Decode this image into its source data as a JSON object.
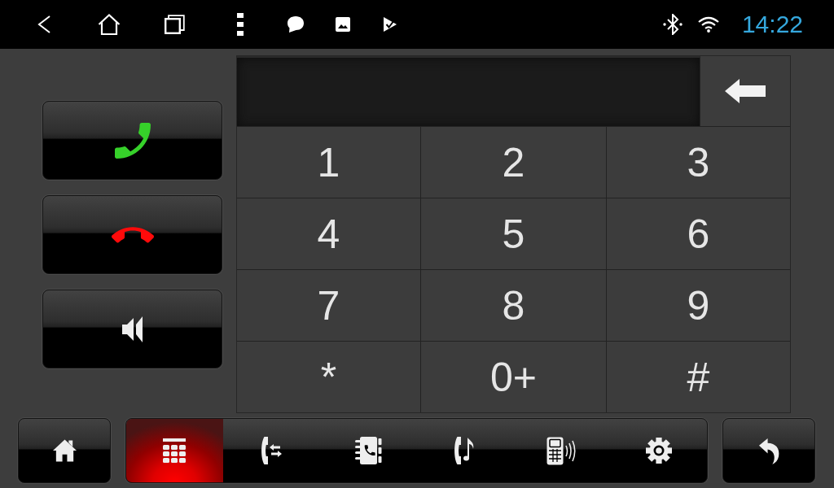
{
  "status_bar": {
    "time": "14:22"
  },
  "call_buttons": [
    {
      "kind": "answer"
    },
    {
      "kind": "hangup"
    },
    {
      "kind": "speaker"
    }
  ],
  "keypad": {
    "keys": [
      "1",
      "2",
      "3",
      "4",
      "5",
      "6",
      "7",
      "8",
      "9",
      "*",
      "0+",
      "#"
    ]
  },
  "bottom_bar": {
    "tabs": [
      {
        "kind": "dialpad",
        "selected": true
      },
      {
        "kind": "call-transfer",
        "selected": false
      },
      {
        "kind": "contacts",
        "selected": false
      },
      {
        "kind": "ringtone",
        "selected": false
      },
      {
        "kind": "phone-link",
        "selected": false
      },
      {
        "kind": "settings",
        "selected": false
      }
    ]
  }
}
